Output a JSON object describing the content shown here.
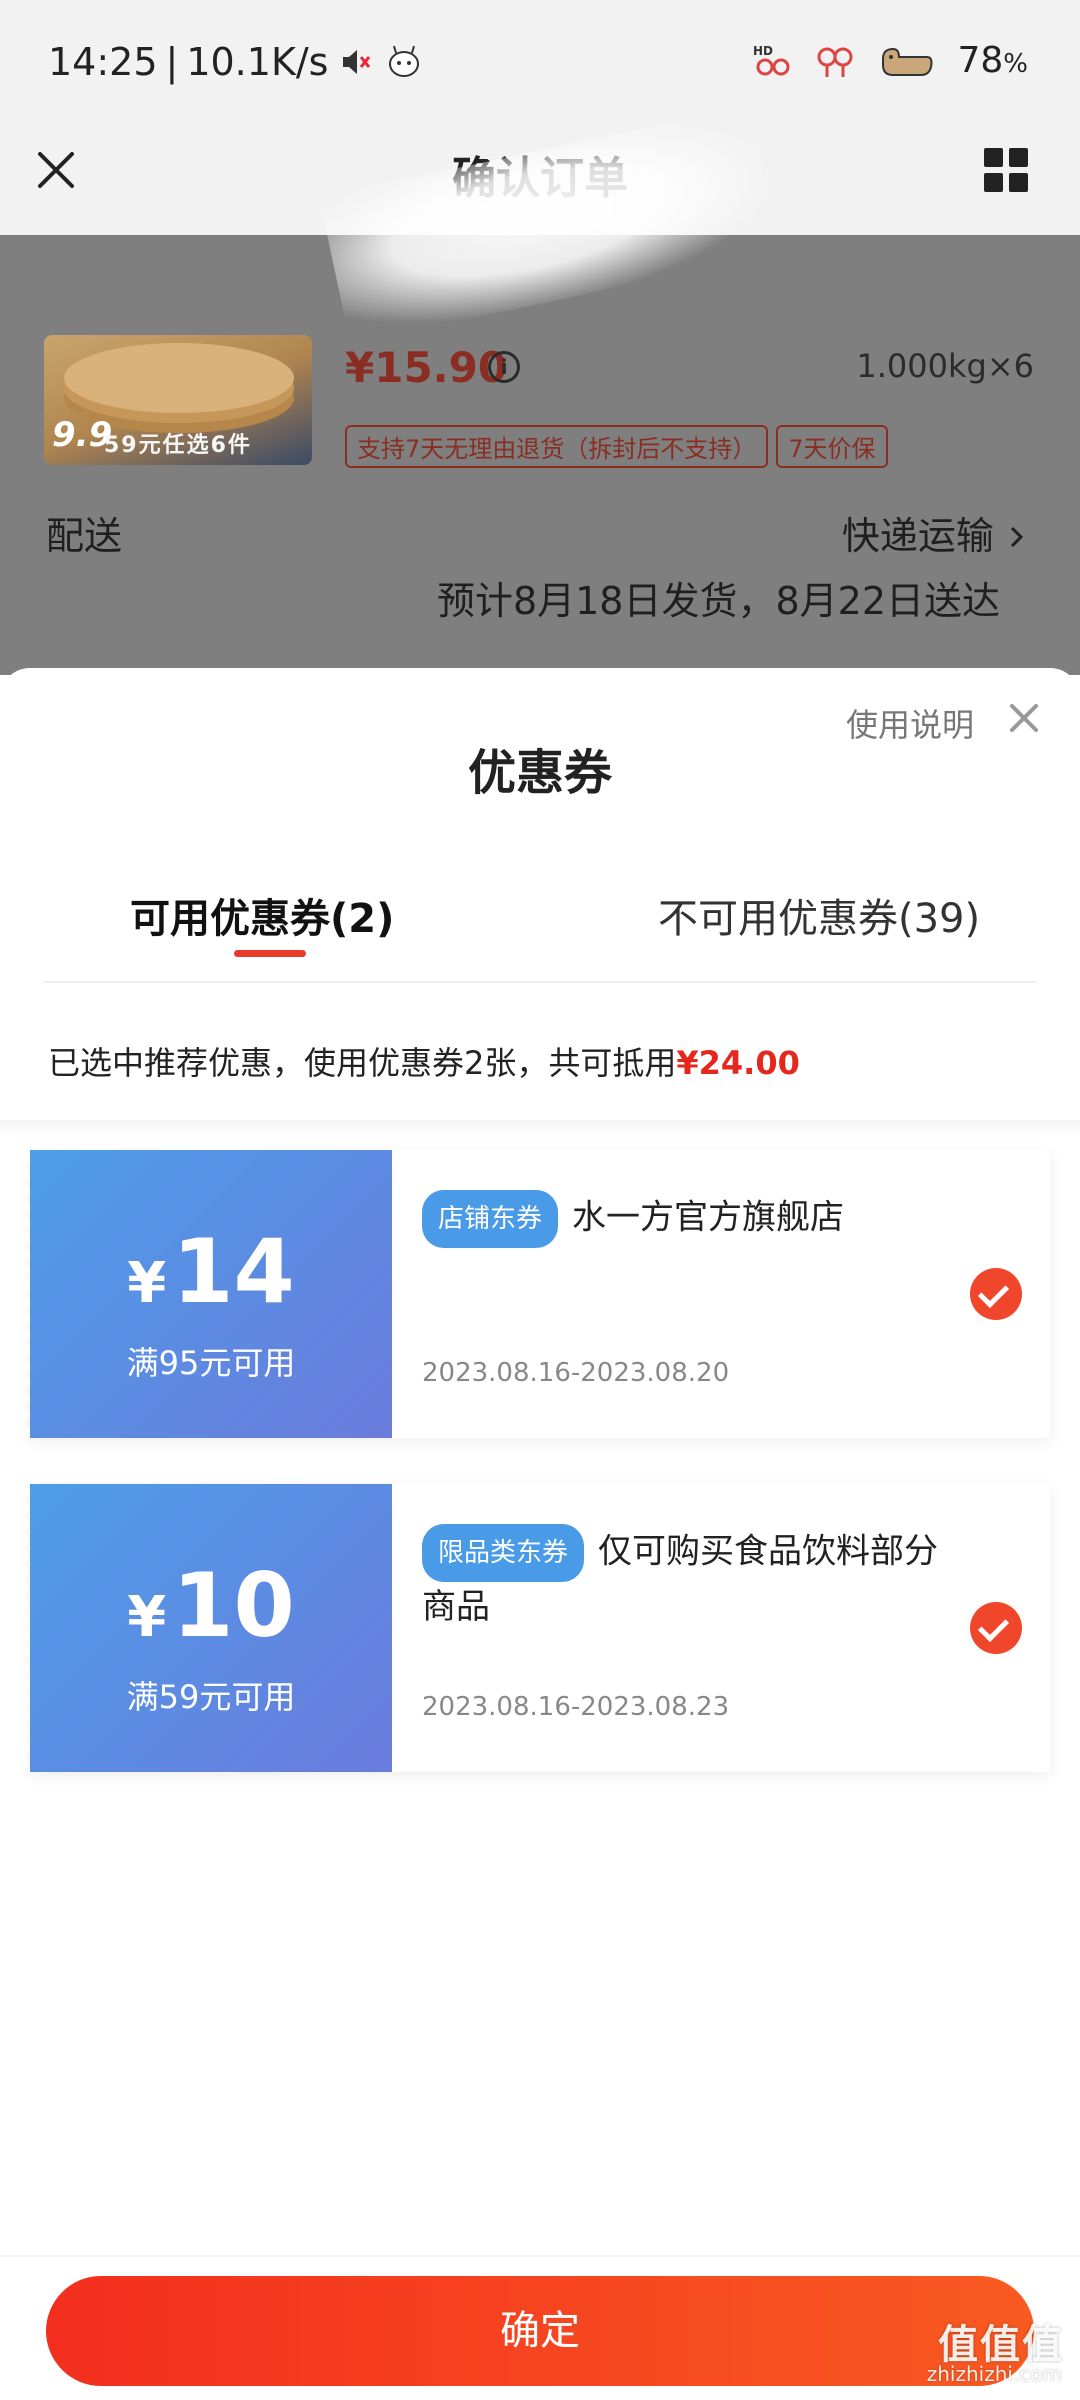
{
  "status_bar": {
    "time": "14:25",
    "network_speed": "10.1K/s",
    "battery_number": "78",
    "battery_unit": "%",
    "icons": [
      "mute-icon",
      "app-icon",
      "hd-signal-icon",
      "signal-icon",
      "battery-icon"
    ]
  },
  "header": {
    "title": "确认订单"
  },
  "order": {
    "product_image_promo": "59元任选6件",
    "product_image_price": "9.9",
    "price": "¥15.90",
    "quantity": "1.000kg×6",
    "tags": [
      "支持7天无理由退货（拆封后不支持）",
      "7天价保"
    ],
    "delivery_label": "配送",
    "delivery_method": "快递运输",
    "delivery_estimate": "预计8月18日发货，8月22日送达"
  },
  "coupon_sheet": {
    "title": "优惠券",
    "usage_link": "使用说明",
    "tabs": [
      {
        "label": "可用优惠券(2)",
        "active": true
      },
      {
        "label": "不可用优惠券(39)",
        "active": false
      }
    ],
    "summary_prefix": "已选中推荐优惠，使用优惠券2张，共可抵用",
    "summary_amount": "¥24.00",
    "coupons": [
      {
        "currency": "¥",
        "amount": "14",
        "condition": "满95元可用",
        "badge": "店铺东券",
        "description": "水一方官方旗舰店",
        "validity": "2023.08.16-2023.08.20",
        "selected": true
      },
      {
        "currency": "¥",
        "amount": "10",
        "condition": "满59元可用",
        "badge": "限品类东券",
        "description": "仅可购买食品饮料部分商品",
        "validity": "2023.08.16-2023.08.23",
        "selected": true
      }
    ],
    "confirm_label": "确定"
  },
  "watermark": {
    "text": "值值值",
    "sub": "zhizhizhi.com"
  },
  "colors": {
    "accent_red": "#e5281d",
    "coupon_gradient_start": "#4d9ee9",
    "coupon_gradient_end": "#6a7bdc",
    "badge_blue": "#4a9be7",
    "confirm_gradient_start": "#f32e1e",
    "confirm_gradient_end": "#f95a21"
  }
}
